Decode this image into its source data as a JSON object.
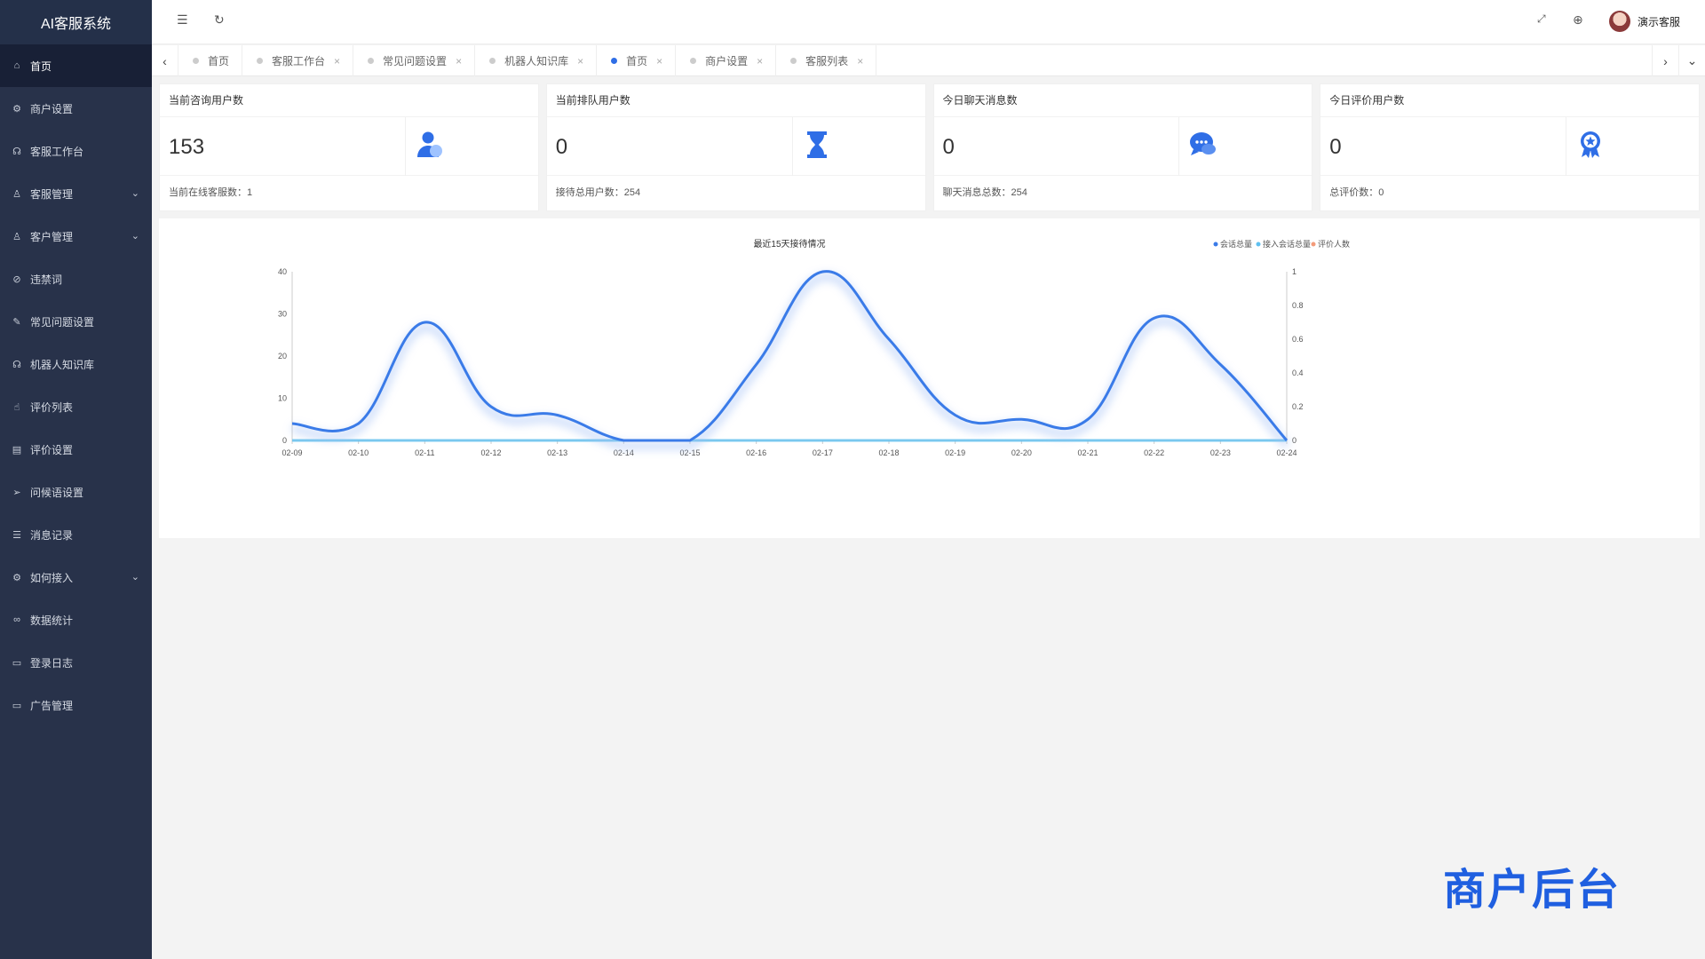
{
  "app": {
    "title": "AI客服系统"
  },
  "sidebar": {
    "items": [
      {
        "label": "首页",
        "icon": "home-icon",
        "glyph": "⌂",
        "active": true,
        "expandable": false
      },
      {
        "label": "商户设置",
        "icon": "settings-icon",
        "glyph": "⚙",
        "active": false,
        "expandable": false
      },
      {
        "label": "客服工作台",
        "icon": "headset-icon",
        "glyph": "☊",
        "active": false,
        "expandable": false
      },
      {
        "label": "客服管理",
        "icon": "user-icon",
        "glyph": "♙",
        "active": false,
        "expandable": true
      },
      {
        "label": "客户管理",
        "icon": "customer-icon",
        "glyph": "♙",
        "active": false,
        "expandable": true
      },
      {
        "label": "违禁词",
        "icon": "ban-icon",
        "glyph": "⊘",
        "active": false,
        "expandable": false
      },
      {
        "label": "常见问题设置",
        "icon": "edit-doc-icon",
        "glyph": "✎",
        "active": false,
        "expandable": false
      },
      {
        "label": "机器人知识库",
        "icon": "robot-icon",
        "glyph": "☊",
        "active": false,
        "expandable": false
      },
      {
        "label": "评价列表",
        "icon": "thumb-up-icon",
        "glyph": "☝",
        "active": false,
        "expandable": false
      },
      {
        "label": "评价设置",
        "icon": "calendar-icon",
        "glyph": "▤",
        "active": false,
        "expandable": false
      },
      {
        "label": "问候语设置",
        "icon": "send-icon",
        "glyph": "➢",
        "active": false,
        "expandable": false
      },
      {
        "label": "消息记录",
        "icon": "list-icon",
        "glyph": "☰",
        "active": false,
        "expandable": false
      },
      {
        "label": "如何接入",
        "icon": "plugin-icon",
        "glyph": "⚙",
        "active": false,
        "expandable": true
      },
      {
        "label": "数据统计",
        "icon": "link-icon",
        "glyph": "∞",
        "active": false,
        "expandable": false
      },
      {
        "label": "登录日志",
        "icon": "log-icon",
        "glyph": "▭",
        "active": false,
        "expandable": false
      },
      {
        "label": "广告管理",
        "icon": "ad-icon",
        "glyph": "▭",
        "active": false,
        "expandable": false
      }
    ]
  },
  "topbar": {
    "user_name": "演示客服"
  },
  "tabs": [
    {
      "label": "首页",
      "active": false,
      "closable": false
    },
    {
      "label": "客服工作台",
      "active": false,
      "closable": true
    },
    {
      "label": "常见问题设置",
      "active": false,
      "closable": true
    },
    {
      "label": "机器人知识库",
      "active": false,
      "closable": true
    },
    {
      "label": "首页",
      "active": true,
      "closable": true
    },
    {
      "label": "商户设置",
      "active": false,
      "closable": true
    },
    {
      "label": "客服列表",
      "active": false,
      "closable": true
    }
  ],
  "cards": [
    {
      "title": "当前咨询用户数",
      "value": "153",
      "footer": "当前在线客服数：1",
      "icon": "user-icon"
    },
    {
      "title": "当前排队用户数",
      "value": "0",
      "footer": "接待总用户数：254",
      "icon": "hourglass-icon"
    },
    {
      "title": "今日聊天消息数",
      "value": "0",
      "footer": "聊天消息总数：254",
      "icon": "chat-icon"
    },
    {
      "title": "今日评价用户数",
      "value": "0",
      "footer": "总评价数：0",
      "icon": "award-icon"
    }
  ],
  "colors": {
    "accent": "#2f6ee6",
    "sidebar_bg": "#28324a",
    "series_1": "#3a7be8",
    "series_2": "#5fc0f0",
    "series_3": "#f39b7a"
  },
  "chart_data": {
    "type": "line",
    "title": "最近15天接待情况",
    "categories": [
      "02-09",
      "02-10",
      "02-11",
      "02-12",
      "02-13",
      "02-14",
      "02-15",
      "02-16",
      "02-17",
      "02-18",
      "02-19",
      "02-20",
      "02-21",
      "02-22",
      "02-23",
      "02-24"
    ],
    "series": [
      {
        "name": "会话总量",
        "axis": "left",
        "values": [
          4,
          4,
          28,
          8,
          6,
          0,
          0,
          18,
          40,
          24,
          6,
          5,
          5,
          29,
          18,
          0
        ]
      },
      {
        "name": "接入会话总量",
        "axis": "left",
        "values": [
          0,
          0,
          0,
          0,
          0,
          0,
          0,
          0,
          0,
          0,
          0,
          0,
          0,
          0,
          0,
          0
        ]
      },
      {
        "name": "评价人数",
        "axis": "right",
        "values": [
          0,
          0,
          0,
          0,
          0,
          0,
          0,
          0,
          0,
          0,
          0,
          0,
          0,
          0,
          0,
          0
        ]
      }
    ],
    "y_left": {
      "min": 0,
      "max": 40,
      "ticks": [
        "0",
        "10",
        "20",
        "30",
        "40"
      ]
    },
    "y_right": {
      "min": 0,
      "max": 1,
      "ticks": [
        "0",
        "0.2",
        "0.4",
        "0.6",
        "0.8",
        "1"
      ]
    },
    "legend_position": "top-right",
    "grid": false
  },
  "watermark": "商户后台"
}
